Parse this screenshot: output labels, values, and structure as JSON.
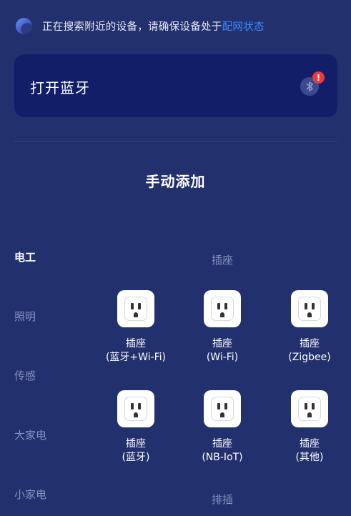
{
  "status": {
    "text": "正在搜索附近的设备，请确保设备处于",
    "link": "配网状态"
  },
  "bluetooth_card": {
    "label": "打开蓝牙",
    "alert": "!"
  },
  "manual_add": {
    "title": "手动添加"
  },
  "categories": [
    {
      "label": "电工",
      "active": true
    },
    {
      "label": "照明",
      "active": false
    },
    {
      "label": "传感",
      "active": false
    },
    {
      "label": "大家电",
      "active": false
    },
    {
      "label": "小家电",
      "active": false
    }
  ],
  "groups": {
    "socket_title": "插座",
    "power_strip_title": "排插"
  },
  "devices": [
    {
      "name": "插座",
      "sub": "(蓝牙+Wi-Fi)"
    },
    {
      "name": "插座",
      "sub": "(Wi-Fi)"
    },
    {
      "name": "插座",
      "sub": "(Zigbee)"
    },
    {
      "name": "插座",
      "sub": "(蓝牙)"
    },
    {
      "name": "插座",
      "sub": "(NB-IoT)"
    },
    {
      "name": "插座",
      "sub": "(其他)"
    }
  ],
  "colors": {
    "background": "#22306e",
    "card": "#121e68",
    "link": "#3b8cff",
    "alert": "#f03a3a",
    "muted_text": "#8792bd"
  }
}
